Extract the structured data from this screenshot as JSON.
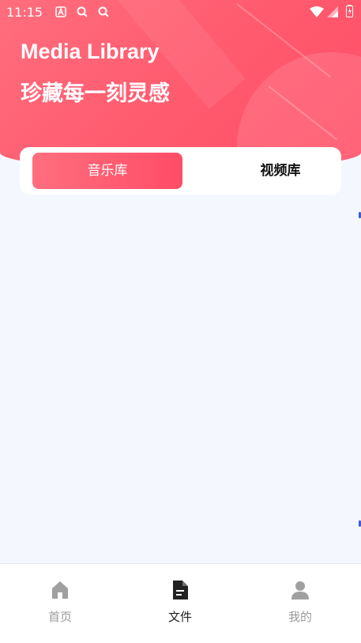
{
  "status_bar": {
    "time": "11:15",
    "icons": [
      "notification-a-icon",
      "search-icon",
      "search-icon",
      "wifi-icon",
      "signal-icon",
      "battery-icon"
    ]
  },
  "header": {
    "title": "Media Library",
    "subtitle": "珍藏每一刻灵感"
  },
  "tabs": [
    {
      "label": "音乐库",
      "active": true
    },
    {
      "label": "视频库",
      "active": false
    }
  ],
  "bottom_nav": [
    {
      "label": "首页",
      "icon": "home-icon",
      "active": false
    },
    {
      "label": "文件",
      "icon": "file-icon",
      "active": true
    },
    {
      "label": "我的",
      "icon": "user-icon",
      "active": false
    }
  ],
  "colors": {
    "accent": "#ff5d70",
    "background": "#f4f7fe",
    "nav_active": "#222222",
    "nav_inactive": "#9a9a9a"
  }
}
